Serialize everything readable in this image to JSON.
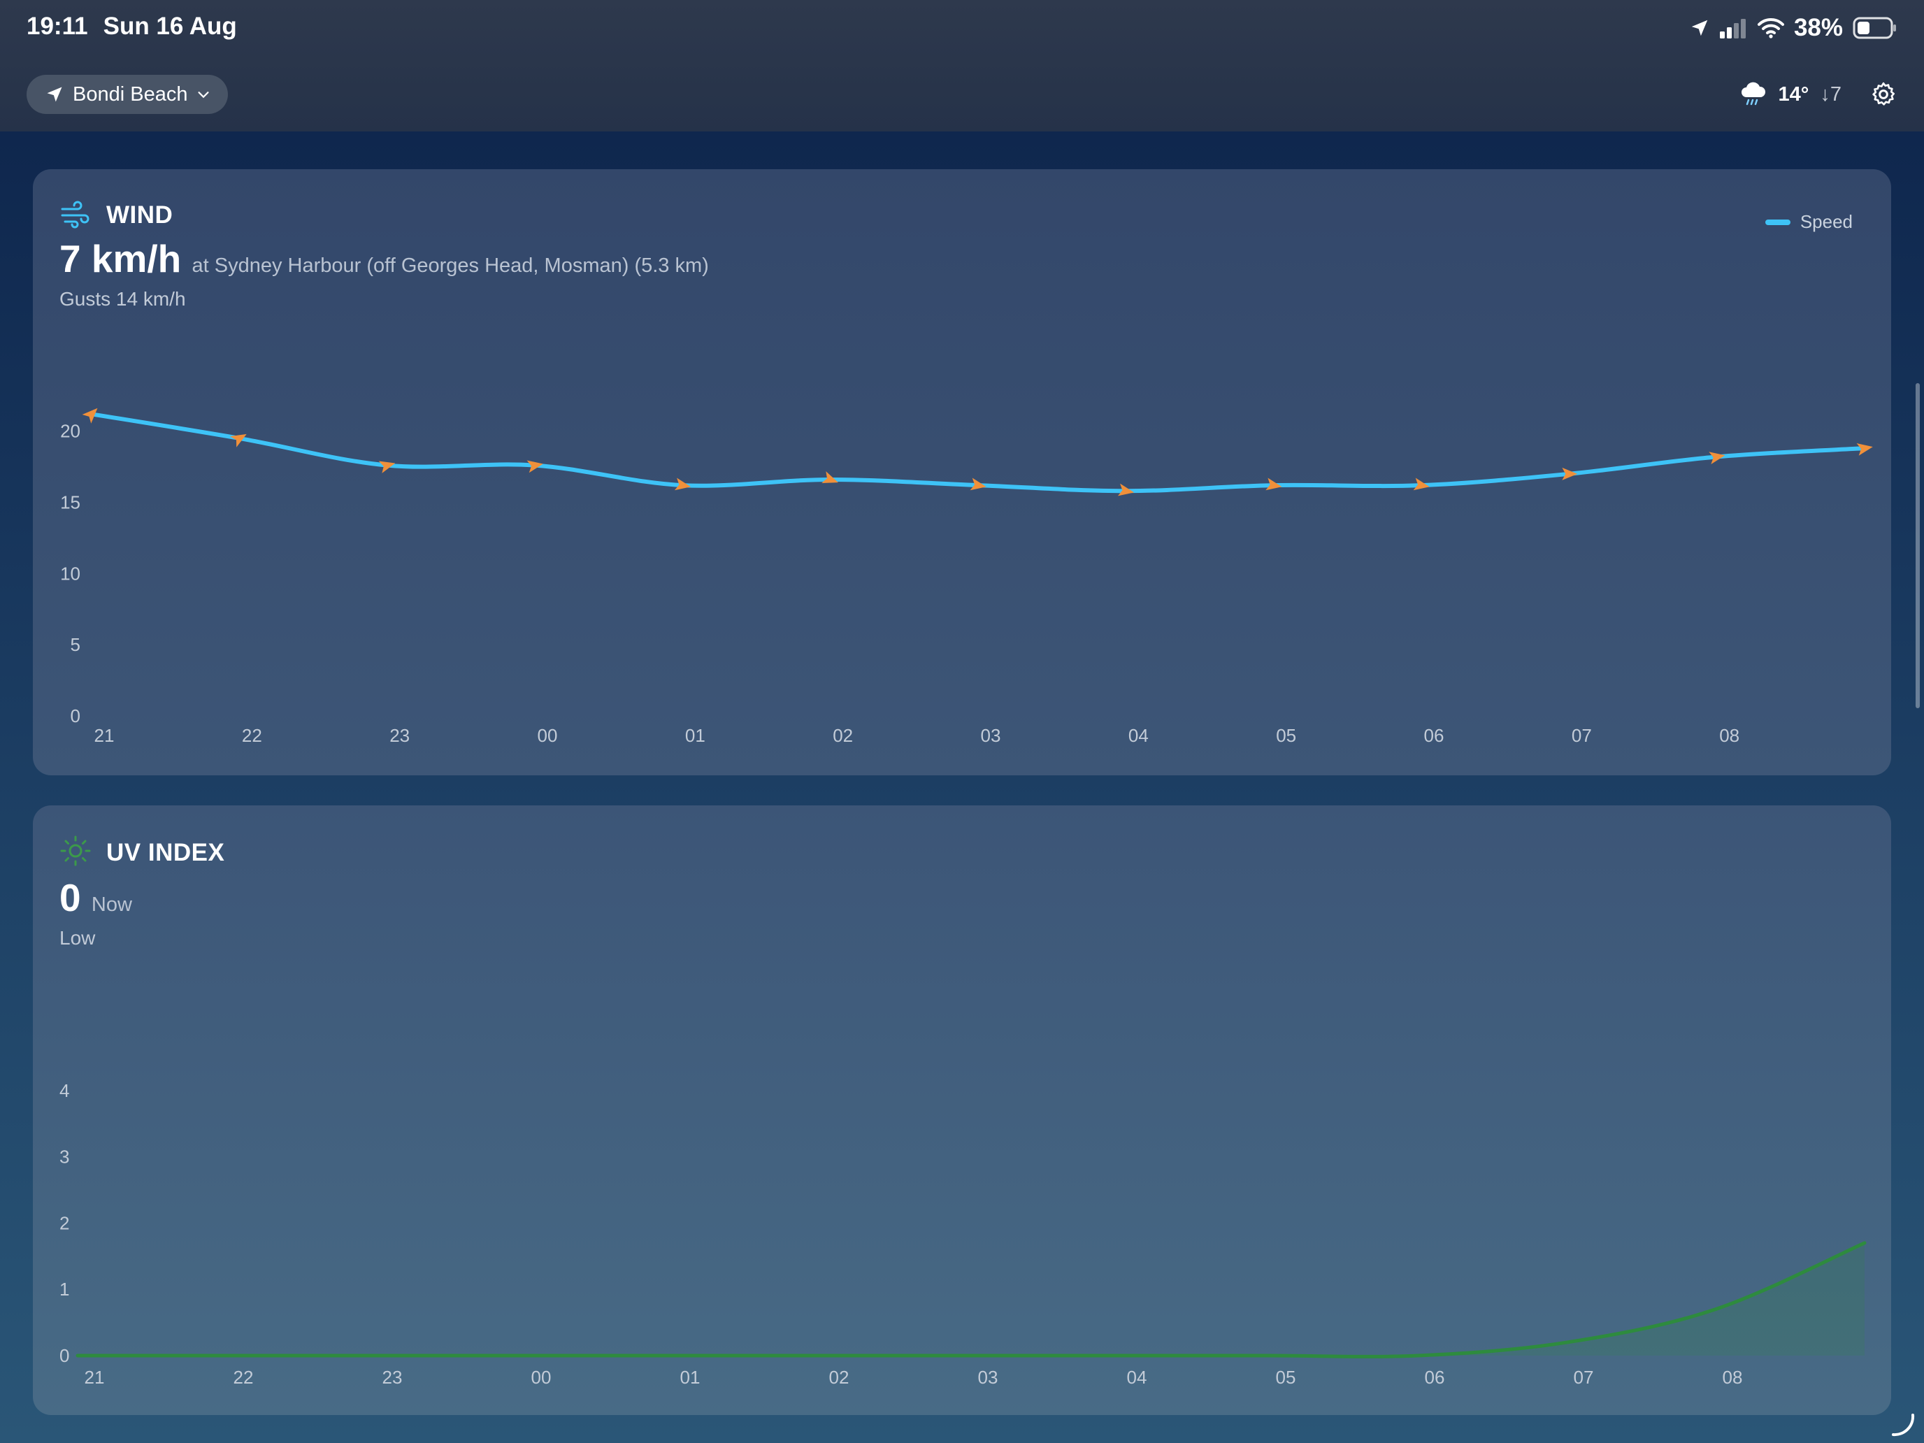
{
  "status_bar": {
    "time": "19:11",
    "date": "Sun 16 Aug",
    "battery": "38%"
  },
  "header": {
    "location": "Bondi Beach",
    "weather_temp": "14°",
    "weather_wind": "↓7"
  },
  "wind": {
    "title": "WIND",
    "speed": "7 km/h",
    "station": "at Sydney Harbour (off Georges Head, Mosman) (5.3 km)",
    "gusts": "Gusts 14 km/h",
    "legend": "Speed",
    "colors": {
      "line": "#3ec3f7",
      "arrow": "#f0903a"
    }
  },
  "uv": {
    "title": "UV INDEX",
    "value": "0",
    "value_label": "Now",
    "level": "Low",
    "colors": {
      "line": "#2e8b3e",
      "icon": "#3c9a4a"
    }
  },
  "chart_data": [
    {
      "type": "line",
      "name": "wind",
      "categories": [
        "21",
        "22",
        "23",
        "00",
        "01",
        "02",
        "03",
        "04",
        "05",
        "06",
        "07",
        "08",
        ""
      ],
      "series": [
        {
          "name": "Speed",
          "values": [
            21.2,
            19.5,
            17.6,
            17.6,
            16.2,
            16.6,
            16.2,
            15.8,
            16.2,
            16.2,
            17.0,
            18.2,
            18.8
          ]
        }
      ],
      "arrow_direction_deg": [
        45,
        60,
        75,
        80,
        100,
        110,
        100,
        100,
        100,
        100,
        90,
        80,
        80
      ],
      "yticks": [
        0,
        5,
        10,
        15,
        20
      ],
      "ylim": [
        0,
        22
      ],
      "xlabel": "",
      "ylabel": "",
      "grid": false,
      "legend": "top-right"
    },
    {
      "type": "area",
      "name": "uv",
      "categories": [
        "21",
        "22",
        "23",
        "00",
        "01",
        "02",
        "03",
        "04",
        "05",
        "06",
        "07",
        "08",
        ""
      ],
      "series": [
        {
          "name": "UV",
          "values": [
            0,
            0,
            0,
            0,
            0,
            0,
            0,
            0,
            0,
            0,
            0.2,
            0.7,
            1.7
          ]
        }
      ],
      "yticks": [
        0,
        1,
        2,
        3,
        4
      ],
      "ylim": [
        0,
        4.6
      ],
      "xlabel": "",
      "ylabel": "",
      "grid": false
    }
  ]
}
